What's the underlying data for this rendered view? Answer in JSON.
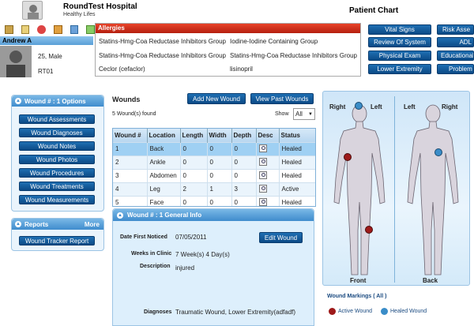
{
  "header": {
    "hospital": "RoundTest Hospital",
    "tagline": "Healthy Lifes",
    "chart_title": "Patient Chart"
  },
  "patient": {
    "name": "Andrew A",
    "age_sex": "25,  Male",
    "room": "RT01"
  },
  "allergies": {
    "title": "Allergies",
    "items": [
      "Statins-Hmg-Coa Reductase Inhibitors Group",
      "Iodine-Iodine Containing Group",
      "Statins-Hmg-Coa Reductase Inhibitors Group",
      "Statins-Hmg-Coa Reductase Inhibitors Group",
      "Ceclor (cefaclor)",
      "lisinopril"
    ]
  },
  "nav_buttons": [
    "Vital Signs",
    "Risk Asse",
    "Review Of System",
    "ADL",
    "Physical Exam",
    "Educational",
    "Lower Extremity",
    "Problem"
  ],
  "wound_options": {
    "title": "Wound # : 1 Options",
    "items": [
      "Wound Assessments",
      "Wound Diagnoses",
      "Wound Notes",
      "Wound Photos",
      "Wound Procedures",
      "Wound Treatments",
      "Wound Measurements"
    ]
  },
  "reports": {
    "title": "Reports",
    "more": "More",
    "button": "Wound Tracker Report"
  },
  "wounds": {
    "title": "Wounds",
    "add": "Add New Wound",
    "view_past": "View Past Wounds",
    "found": "5 Wound(s) found",
    "show_label": "Show",
    "show_value": "All",
    "columns": [
      "Wound #",
      "Location",
      "Length",
      "Width",
      "Depth",
      "Desc",
      "Status"
    ],
    "rows": [
      [
        "1",
        "Back",
        "0",
        "0",
        "0",
        "Healed"
      ],
      [
        "2",
        "Ankle",
        "0",
        "0",
        "0",
        "Healed"
      ],
      [
        "3",
        "Abdomen",
        "0",
        "0",
        "0",
        "Healed"
      ],
      [
        "4",
        "Leg",
        "2",
        "1",
        "3",
        "Active"
      ],
      [
        "5",
        "Face",
        "0",
        "0",
        "0",
        "Healed"
      ]
    ]
  },
  "general_info": {
    "title": "Wound # : 1 General Info",
    "date_label": "Date First Noticed",
    "date_value": "07/05/2011",
    "edit": "Edit Wound",
    "weeks_label": "Weeks in Clinic",
    "weeks_value": "7 Week(s) 4 Day(s)",
    "desc_label": "Description",
    "desc_value": "injured",
    "diag_label": "Diagnoses",
    "diag_value": "Traumatic Wound, Lower Extremity(adfadf)"
  },
  "body_map": {
    "front_right": "Right",
    "front_left": "Left",
    "back_left": "Left",
    "back_right": "Right",
    "front": "Front",
    "back": "Back",
    "markings_label": "Wound Markings",
    "markings_all": "( All )",
    "active_label": "Active Wound",
    "healed_label": "Healed Wound",
    "active_color": "#9e1a1a",
    "healed_color": "#3a8dc8"
  },
  "icons": [
    "home-icon",
    "document-icon",
    "pill-icon",
    "box-icon",
    "calendar-icon",
    "exit-icon"
  ]
}
